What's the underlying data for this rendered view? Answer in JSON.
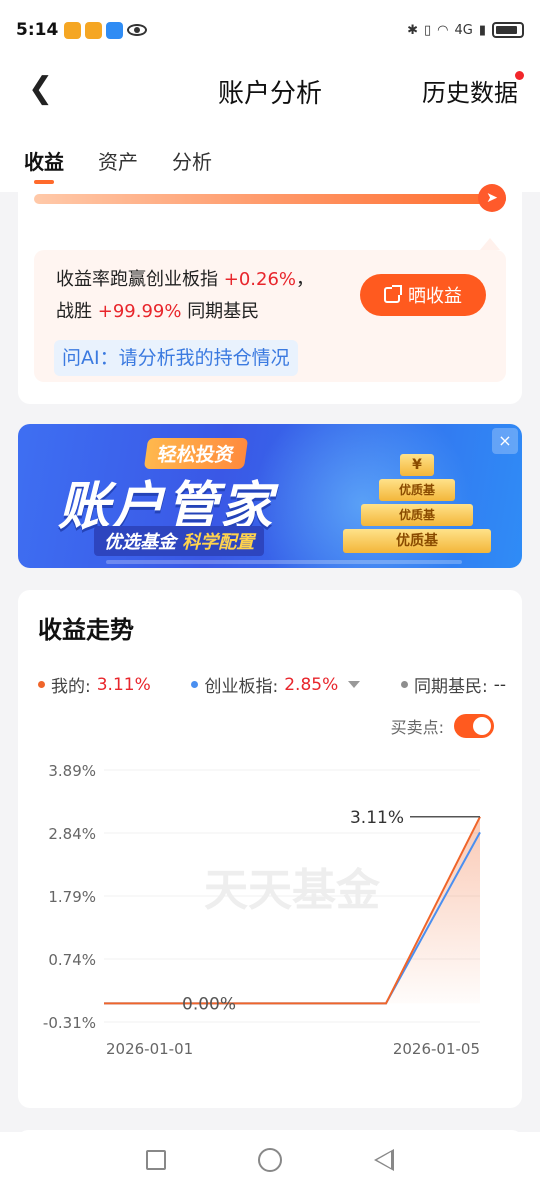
{
  "status_bar": {
    "time": "5:14",
    "network": "4G"
  },
  "nav": {
    "title": "账户分析",
    "right_label": "历史数据"
  },
  "tabs": [
    {
      "label": "收益",
      "active": true
    },
    {
      "label": "资产",
      "active": false
    },
    {
      "label": "分析",
      "active": false
    }
  ],
  "summary": {
    "line1_prefix": "收益率跑赢创业板指",
    "line1_value": "+0.26%",
    "line1_suffix": "，",
    "line2_prefix": "战胜",
    "line2_value": "+99.99%",
    "line2_suffix": "同期基民",
    "share_button": "晒收益",
    "ai_prompt": "问AI：请分析我的持仓情况"
  },
  "banner": {
    "tag": "轻松投资",
    "title": "账户管家",
    "subtitle_a": "优选基金",
    "subtitle_b": "科学配置",
    "pyramid_top": "¥",
    "pyramid_levels": [
      "优质基",
      "优质基",
      "优质基"
    ],
    "close": "×"
  },
  "trend": {
    "title": "收益走势",
    "legend": [
      {
        "label": "我的:",
        "value": "3.11%",
        "color": "#f0652a"
      },
      {
        "label": "创业板指:",
        "value": "2.85%",
        "color": "#4a8ff0"
      },
      {
        "label": "同期基民:",
        "value": "--",
        "color": "#8e8e8e"
      }
    ],
    "trade_points_label": "买卖点:",
    "trade_points_on": true,
    "watermark": "天天基金",
    "callout_end": "3.11%",
    "callout_start": "0.00%"
  },
  "chart_data": {
    "type": "line",
    "x": [
      "2026-01-01",
      "2026-01-02",
      "2026-01-03",
      "2026-01-04",
      "2026-01-05"
    ],
    "x_tick_labels": [
      "2026-01-01",
      "2026-01-05"
    ],
    "y_tick_labels": [
      "3.89%",
      "2.84%",
      "1.79%",
      "0.74%",
      "-0.31%"
    ],
    "y_ticks": [
      3.89,
      2.84,
      1.79,
      0.74,
      -0.31
    ],
    "ylim": [
      -0.31,
      3.89
    ],
    "grid": true,
    "series": [
      {
        "name": "我的",
        "color": "#f0652a",
        "values": [
          0.0,
          0.0,
          0.0,
          0.0,
          3.11
        ]
      },
      {
        "name": "创业板指",
        "color": "#4a8ff0",
        "values": [
          0.0,
          0.0,
          0.0,
          0.0,
          2.85
        ]
      }
    ]
  },
  "colors": {
    "accent": "#ff5a1f",
    "rise_red": "#e8262c",
    "link_blue": "#3b7ae0"
  }
}
